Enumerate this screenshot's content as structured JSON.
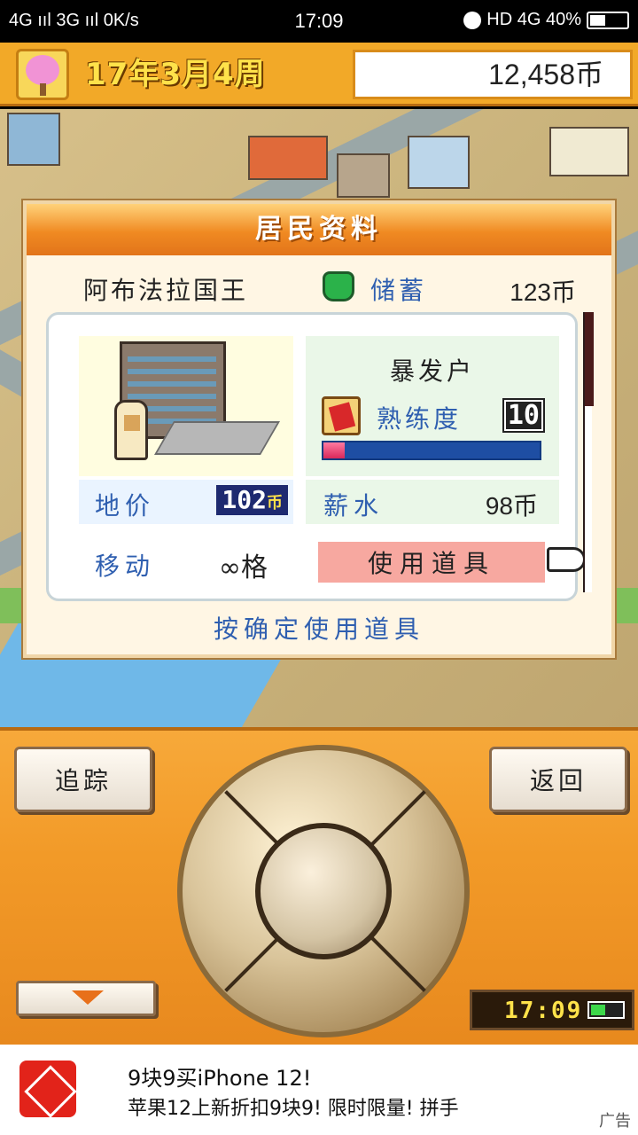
{
  "status_bar": {
    "network": "4G ııl 3G ııl 0K/s",
    "time": "17:09",
    "right": "HD 4G 40%"
  },
  "top_bar": {
    "date": "17年3月4周",
    "money": "12,458币"
  },
  "panel": {
    "title": "居民资料",
    "resident_name": "阿布法拉国王",
    "savings_label": "储蓄",
    "savings_value": "123币",
    "occupation": "暴发户",
    "skill_label": "熟练度",
    "skill_value": "10",
    "skill_progress": 0.1,
    "land_price_label": "地价",
    "land_price_value": "102",
    "land_price_unit": "币",
    "salary_label": "薪水",
    "salary_value": "98币",
    "move_label": "移动",
    "move_value": "∞格",
    "use_item_button": "使用道具",
    "hint": "按确定使用道具"
  },
  "controller": {
    "track_button": "追踪",
    "back_button": "返回",
    "clock": "17:09",
    "accent_color": "#f29a28"
  },
  "ad": {
    "title": "9块9买iPhone 12!",
    "description": "苹果12上新折扣9块9! 限时限量! 拼手",
    "tag": "广告"
  }
}
